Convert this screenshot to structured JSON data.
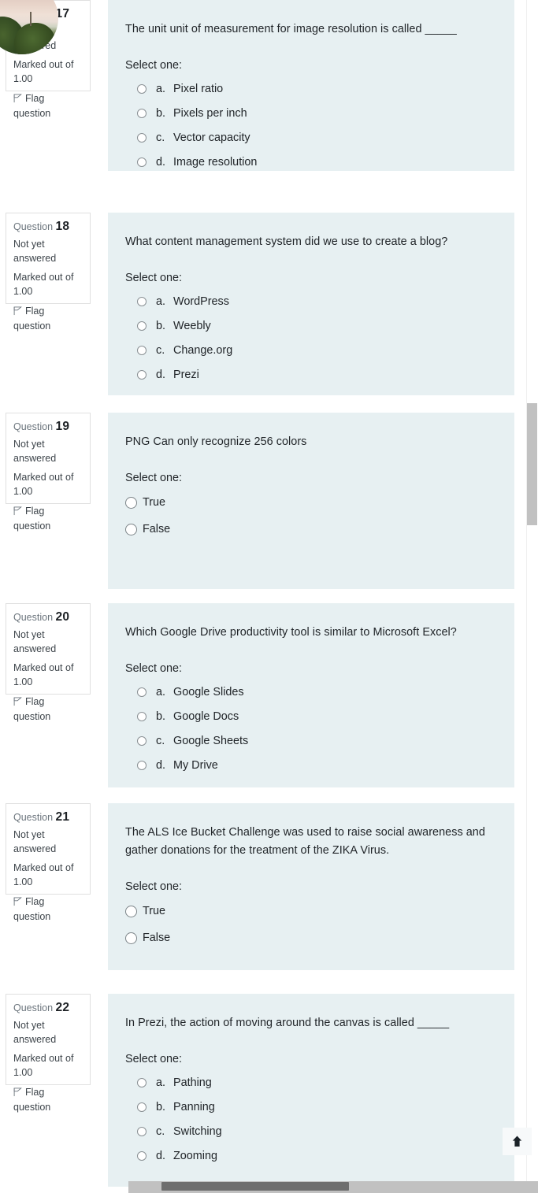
{
  "theme": {
    "content_bg": "#e7f0f2",
    "info_bg": "#ffffff",
    "info_border": "#e0e0e0",
    "page_bg": "#ffffff",
    "text": "#212529",
    "muted": "#6c757d",
    "scrollbar_track": "#c1c1c1",
    "scrollbar_thumb": "#6e6e6e"
  },
  "labels": {
    "question_word": "Question",
    "not_yet_answered": "Not yet answered",
    "marked_out_of": "Marked out of 1.00",
    "flag_question": "Flag question",
    "select_one": "Select one:"
  },
  "scroll_top_button": {
    "icon": "arrow-up-icon"
  },
  "questions": [
    {
      "number": "17",
      "state": "Not yet answered",
      "marks": "Marked out of 1.00",
      "flag": "Flag question",
      "partially_obscured": true,
      "text": "The unit unit of measurement for image resolution is called _____",
      "select_one": "Select one:",
      "answer_type": "multiple-choice",
      "answers": [
        {
          "letter": "a.",
          "label": "Pixel ratio"
        },
        {
          "letter": "b.",
          "label": "Pixels per inch"
        },
        {
          "letter": "c.",
          "label": "Vector capacity"
        },
        {
          "letter": "d.",
          "label": "Image resolution"
        }
      ]
    },
    {
      "number": "18",
      "state": "Not yet answered",
      "marks": "Marked out of 1.00",
      "flag": "Flag question",
      "text": "What content management system did we use to create a blog?",
      "select_one": "Select one:",
      "answer_type": "multiple-choice",
      "answers": [
        {
          "letter": "a.",
          "label": "WordPress"
        },
        {
          "letter": "b.",
          "label": "Weebly"
        },
        {
          "letter": "c.",
          "label": "Change.org"
        },
        {
          "letter": "d.",
          "label": "Prezi"
        }
      ]
    },
    {
      "number": "19",
      "state": "Not yet answered",
      "marks": "Marked out of 1.00",
      "flag": "Flag question",
      "text": "PNG Can only recognize 256 colors",
      "select_one": "Select one:",
      "answer_type": "true-false",
      "answers": [
        {
          "letter": "",
          "label": "True"
        },
        {
          "letter": "",
          "label": "False"
        }
      ]
    },
    {
      "number": "20",
      "state": "Not yet answered",
      "marks": "Marked out of 1.00",
      "flag": "Flag question",
      "text": "Which Google Drive productivity tool is similar to Microsoft Excel?",
      "select_one": "Select one:",
      "answer_type": "multiple-choice",
      "answers": [
        {
          "letter": "a.",
          "label": "Google Slides"
        },
        {
          "letter": "b.",
          "label": "Google Docs"
        },
        {
          "letter": "c.",
          "label": "Google Sheets"
        },
        {
          "letter": "d.",
          "label": "My Drive"
        }
      ]
    },
    {
      "number": "21",
      "state": "Not yet answered",
      "marks": "Marked out of 1.00",
      "flag": "Flag question",
      "text": "The ALS Ice Bucket Challenge was used to raise social awareness and gather donations for the treatment of the ZIKA Virus.",
      "select_one": "Select one:",
      "answer_type": "true-false",
      "answers": [
        {
          "letter": "",
          "label": "True"
        },
        {
          "letter": "",
          "label": "False"
        }
      ]
    },
    {
      "number": "22",
      "state": "Not yet answered",
      "marks": "Marked out of 1.00",
      "flag": "Flag question",
      "text": "In Prezi, the action of moving around the canvas is called _____",
      "select_one": "Select one:",
      "answer_type": "multiple-choice",
      "answers": [
        {
          "letter": "a.",
          "label": "Pathing"
        },
        {
          "letter": "b.",
          "label": "Panning"
        },
        {
          "letter": "c.",
          "label": "Switching"
        },
        {
          "letter": "d.",
          "label": "Zooming"
        }
      ]
    }
  ]
}
